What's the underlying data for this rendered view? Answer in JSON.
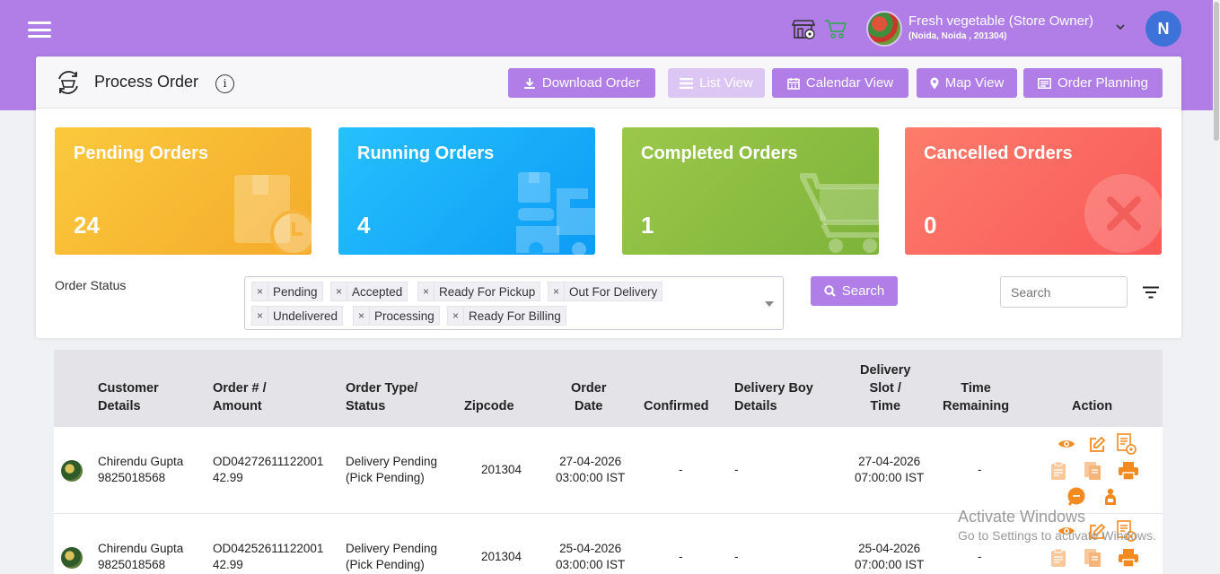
{
  "store": {
    "name": "Fresh vegetable (Store Owner)",
    "location": "(Noida, Noida , 201304)"
  },
  "user": {
    "initial": "N"
  },
  "page": {
    "title": "Process Order",
    "info": "i"
  },
  "header_buttons": {
    "download": "Download Order",
    "list": "List View",
    "calendar": "Calendar View",
    "map": "Map View",
    "planning": "Order Planning"
  },
  "stats": [
    {
      "title": "Pending Orders",
      "count": "24",
      "color": "#f7b733"
    },
    {
      "title": "Running Orders",
      "count": "4",
      "color": "#1eaefc"
    },
    {
      "title": "Completed Orders",
      "count": "1",
      "color": "#8bbf3e"
    },
    {
      "title": "Cancelled Orders",
      "count": "0",
      "color": "#fb6e62"
    }
  ],
  "filter": {
    "label": "Order Status",
    "chips": [
      "Pending",
      "Accepted",
      "Ready For Pickup",
      "Out For Delivery",
      "Undelivered",
      "Processing",
      "Ready For Billing"
    ],
    "search_button": "Search",
    "search_placeholder": "Search"
  },
  "table": {
    "headers": {
      "customer": [
        "Customer",
        "Details"
      ],
      "order": [
        "Order # /",
        "Amount"
      ],
      "type": [
        "Order Type/",
        "Status"
      ],
      "zip": [
        "Zipcode"
      ],
      "date": [
        "Order",
        "Date"
      ],
      "confirmed": [
        "Confirmed"
      ],
      "boy": [
        "Delivery Boy",
        "Details"
      ],
      "slot": [
        "Delivery",
        "Slot /",
        "Time"
      ],
      "remaining": [
        "Time",
        "Remaining"
      ],
      "action": [
        "Action"
      ]
    },
    "rows": [
      {
        "name": "Chirendu Gupta",
        "phone": "9825018568",
        "order_no": "OD04272611122001",
        "amount": "42.99",
        "type": "Delivery Pending",
        "status": "(Pick Pending)",
        "zip": "201304",
        "date": "27-04-2026",
        "time": "03:00:00 IST",
        "confirmed": "-",
        "boy": "-",
        "slot_date": "27-04-2026",
        "slot_time": "07:00:00 IST",
        "remaining": "-"
      },
      {
        "name": "Chirendu Gupta",
        "phone": "9825018568",
        "order_no": "OD04252611122001",
        "amount": "42.99",
        "type": "Delivery Pending",
        "status": "(Pick Pending)",
        "zip": "201304",
        "date": "25-04-2026",
        "time": "03:00:00 IST",
        "confirmed": "-",
        "boy": "-",
        "slot_date": "25-04-2026",
        "slot_time": "07:00:00 IST",
        "remaining": "-"
      }
    ]
  },
  "watermark": {
    "line1": "Activate Windows",
    "line2": "Go to Settings to activate Windows."
  },
  "colors": {
    "topbar": "#b07ee6",
    "button": "#b07ee6",
    "action_icon": "#f28a1f",
    "action_icon_light": "#f8c79a"
  }
}
